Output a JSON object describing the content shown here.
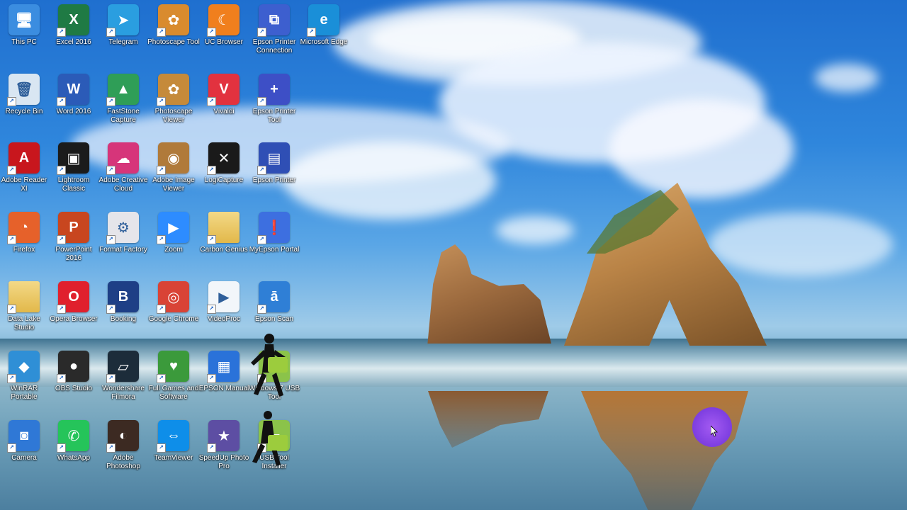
{
  "desktop": {
    "icons": [
      {
        "label": "This PC",
        "icon": "computer-icon",
        "color": "#3b8de0",
        "glyph": "🖥",
        "col": 0,
        "row": 0
      },
      {
        "label": "Excel 2016",
        "icon": "excel-icon",
        "color": "#1f7a44",
        "glyph": "X",
        "col": 1,
        "row": 0
      },
      {
        "label": "Telegram",
        "icon": "telegram-icon",
        "color": "#2a9ee0",
        "glyph": "➤",
        "col": 2,
        "row": 0
      },
      {
        "label": "Photoscape Tool",
        "icon": "photoscape-icon",
        "color": "#d98b2e",
        "glyph": "✿",
        "col": 3,
        "row": 0
      },
      {
        "label": "UC Browser",
        "icon": "uc-browser-icon",
        "color": "#f07f1d",
        "glyph": "☾",
        "col": 4,
        "row": 0
      },
      {
        "label": "Epson Printer Connection",
        "icon": "epson-connection-icon",
        "color": "#3d5fcf",
        "glyph": "⧉",
        "col": 5,
        "row": 0
      },
      {
        "label": "Microsoft Edge",
        "icon": "edge-icon",
        "color": "#1a8fd8",
        "glyph": "e",
        "col": 6,
        "row": 0
      },
      {
        "label": "Recycle Bin",
        "icon": "recycle-bin-icon",
        "color": "#d9e6f2",
        "glyph": "🗑",
        "col": 0,
        "row": 1
      },
      {
        "label": "Word 2016",
        "icon": "word-icon",
        "color": "#2b5bb8",
        "glyph": "W",
        "col": 1,
        "row": 1
      },
      {
        "label": "FastStone Capture",
        "icon": "faststone-capture-icon",
        "color": "#2f9e57",
        "glyph": "▲",
        "col": 2,
        "row": 1
      },
      {
        "label": "Photoscape Viewer",
        "icon": "photoscape-viewer-icon",
        "color": "#c58a3a",
        "glyph": "✿",
        "col": 3,
        "row": 1
      },
      {
        "label": "Vivaldi",
        "icon": "vivaldi-icon",
        "color": "#e2323f",
        "glyph": "V",
        "col": 4,
        "row": 1
      },
      {
        "label": "Epson Printer Tool",
        "icon": "epson-tool-icon",
        "color": "#3d4fc6",
        "glyph": "+",
        "col": 5,
        "row": 1
      },
      {
        "label": "Adobe Reader XI",
        "icon": "adobe-reader-icon",
        "color": "#c8161d",
        "glyph": "A",
        "col": 0,
        "row": 2
      },
      {
        "label": "Lightroom Classic",
        "icon": "lightroom-icon",
        "color": "#1b1b1b",
        "glyph": "▣",
        "col": 1,
        "row": 2
      },
      {
        "label": "Adobe Creative Cloud",
        "icon": "creative-cloud-icon",
        "color": "#d6357a",
        "glyph": "☁",
        "col": 2,
        "row": 2
      },
      {
        "label": "Adobe Image Viewer",
        "icon": "image-viewer-icon",
        "color": "#b07a3a",
        "glyph": "◉",
        "col": 3,
        "row": 2
      },
      {
        "label": "LogiCapture",
        "icon": "logicapture-icon",
        "color": "#1a1a1a",
        "glyph": "✕",
        "col": 4,
        "row": 2
      },
      {
        "label": "Epson Printer",
        "icon": "epson-printer-icon",
        "color": "#2f4fb5",
        "glyph": "▤",
        "col": 5,
        "row": 2
      },
      {
        "label": "Firefox",
        "icon": "firefox-icon",
        "color": "#e6612a",
        "glyph": "◔",
        "col": 0,
        "row": 3
      },
      {
        "label": "PowerPoint 2016",
        "icon": "powerpoint-icon",
        "color": "#c8461f",
        "glyph": "P",
        "col": 1,
        "row": 3
      },
      {
        "label": "Format Factory",
        "icon": "format-factory-icon",
        "color": "#e5e5ea",
        "glyph": "⚙",
        "col": 2,
        "row": 3
      },
      {
        "label": "Zoom",
        "icon": "zoom-icon",
        "color": "#2d8cff",
        "glyph": "▶",
        "col": 3,
        "row": 3
      },
      {
        "label": "Carbon Genius",
        "icon": "folder-icon",
        "color": "#e8c768",
        "glyph": "",
        "col": 4,
        "row": 3
      },
      {
        "label": "MyEpson Portal",
        "icon": "myepson-portal-icon",
        "color": "#3d6fe0",
        "glyph": "❗",
        "col": 5,
        "row": 3
      },
      {
        "label": "Data Lake Studio",
        "icon": "folder-icon",
        "color": "#e8c768",
        "glyph": "",
        "col": 0,
        "row": 4
      },
      {
        "label": "Opera Browser",
        "icon": "opera-icon",
        "color": "#e0202d",
        "glyph": "O",
        "col": 1,
        "row": 4
      },
      {
        "label": "Booking",
        "icon": "booking-icon",
        "color": "#1e3f86",
        "glyph": "B",
        "col": 2,
        "row": 4
      },
      {
        "label": "Google Chrome",
        "icon": "chrome-icon",
        "color": "#d94336",
        "glyph": "◎",
        "col": 3,
        "row": 4
      },
      {
        "label": "VideoProc",
        "icon": "videoproc-icon",
        "color": "#f2f6fa",
        "glyph": "▶",
        "col": 4,
        "row": 4
      },
      {
        "label": "Epson Scan",
        "icon": "epson-scan-icon",
        "color": "#2f7fd6",
        "glyph": "ā",
        "col": 5,
        "row": 4
      },
      {
        "label": "WinRAR Portable",
        "icon": "winrar-icon",
        "color": "#2f8fd6",
        "glyph": "◆",
        "col": 0,
        "row": 5
      },
      {
        "label": "OBS Studio",
        "icon": "obs-icon",
        "color": "#2a2a2a",
        "glyph": "●",
        "col": 1,
        "row": 5
      },
      {
        "label": "Wondershare Filmora",
        "icon": "filmora-icon",
        "color": "#1c2c3a",
        "glyph": "▱",
        "col": 2,
        "row": 5
      },
      {
        "label": "Full Games and Software",
        "icon": "games-software-icon",
        "color": "#3b9a3b",
        "glyph": "♥",
        "col": 3,
        "row": 5
      },
      {
        "label": "EPSON Manual",
        "icon": "epson-manual-icon",
        "color": "#2a72d9",
        "glyph": "▦",
        "col": 4,
        "row": 5
      },
      {
        "label": "Windows 7 USB Tool",
        "icon": "usb-tool-icon",
        "color": "#8bc34a",
        "glyph": "▰",
        "col": 5,
        "row": 5
      },
      {
        "label": "Camera",
        "icon": "camera-icon",
        "color": "#2f78d6",
        "glyph": "◙",
        "col": 0,
        "row": 6
      },
      {
        "label": "WhatsApp",
        "icon": "whatsapp-icon",
        "color": "#25c45a",
        "glyph": "✆",
        "col": 1,
        "row": 6
      },
      {
        "label": "Adobe Photoshop",
        "icon": "photoshop-icon",
        "color": "#3c2a22",
        "glyph": "◐",
        "col": 2,
        "row": 6
      },
      {
        "label": "TeamViewer",
        "icon": "teamviewer-icon",
        "color": "#0e8ee9",
        "glyph": "⇔",
        "col": 3,
        "row": 6
      },
      {
        "label": "SpeedUp Photo Pro",
        "icon": "speedup-icon",
        "color": "#5d4ea3",
        "glyph": "★",
        "col": 4,
        "row": 6
      },
      {
        "label": "USB Tool Installer",
        "icon": "usb-installer-icon",
        "color": "#8bc34a",
        "glyph": "▰",
        "col": 5,
        "row": 6
      }
    ]
  },
  "colors": {
    "cursor_highlight": "#8a47e6",
    "label_text": "#ffffff"
  }
}
